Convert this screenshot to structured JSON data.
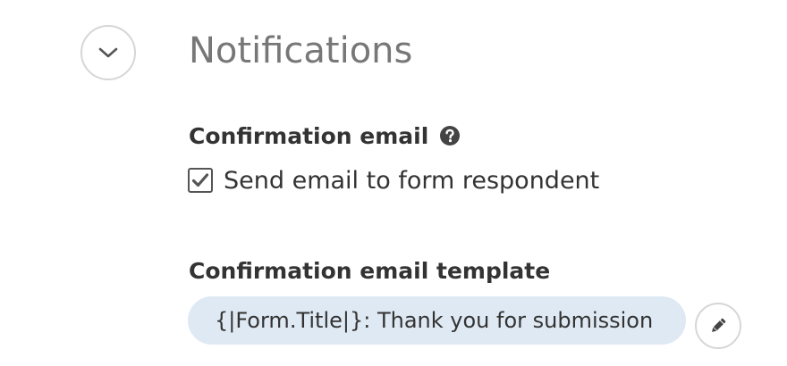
{
  "section": {
    "title": "Notifications",
    "toggle_icon": "chevron-down-icon"
  },
  "confirmation": {
    "label": "Confirmation email",
    "help_icon": "question-circle-icon",
    "send_to_respondent": {
      "label": "Send email to form respondent",
      "checked": true
    }
  },
  "template": {
    "label": "Confirmation email template",
    "value": "{|Form.Title|}: Thank you for submission",
    "edit_icon": "pencil-icon"
  },
  "colors": {
    "title": "#777777",
    "label": "#333333",
    "field_background": "#dfe9f3",
    "circle_border": "#d6d6d6"
  }
}
